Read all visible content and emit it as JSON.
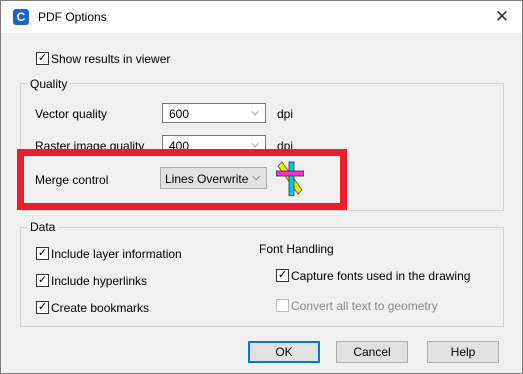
{
  "window": {
    "title": "PDF Options",
    "app_icon": "C",
    "close": "✕"
  },
  "show_results": {
    "label": "Show results in viewer",
    "checked": true
  },
  "quality": {
    "title": "Quality",
    "vector_label": "Vector quality",
    "vector_value": "600",
    "vector_unit": "dpi",
    "raster_label": "Raster image quality",
    "raster_value": "400",
    "raster_unit": "dpi",
    "merge_label": "Merge control",
    "merge_value": "Lines Overwrite"
  },
  "data_group": {
    "title": "Data",
    "include_layer": {
      "label": "Include layer information",
      "checked": true
    },
    "include_hyperlinks": {
      "label": "Include hyperlinks",
      "checked": true
    },
    "create_bookmarks": {
      "label": "Create bookmarks",
      "checked": true
    },
    "font_handling_title": "Font Handling",
    "capture_fonts": {
      "label": "Capture fonts used in the drawing",
      "checked": true
    },
    "convert_text": {
      "label": "Convert all text to geometry",
      "checked": false,
      "enabled": false
    }
  },
  "buttons": {
    "ok": "OK",
    "cancel": "Cancel",
    "help": "Help"
  },
  "icons": {
    "check": "✓",
    "chevron": "⌵"
  },
  "colors": {
    "highlight": "#ee1d2b",
    "accent": "#0078d7"
  }
}
